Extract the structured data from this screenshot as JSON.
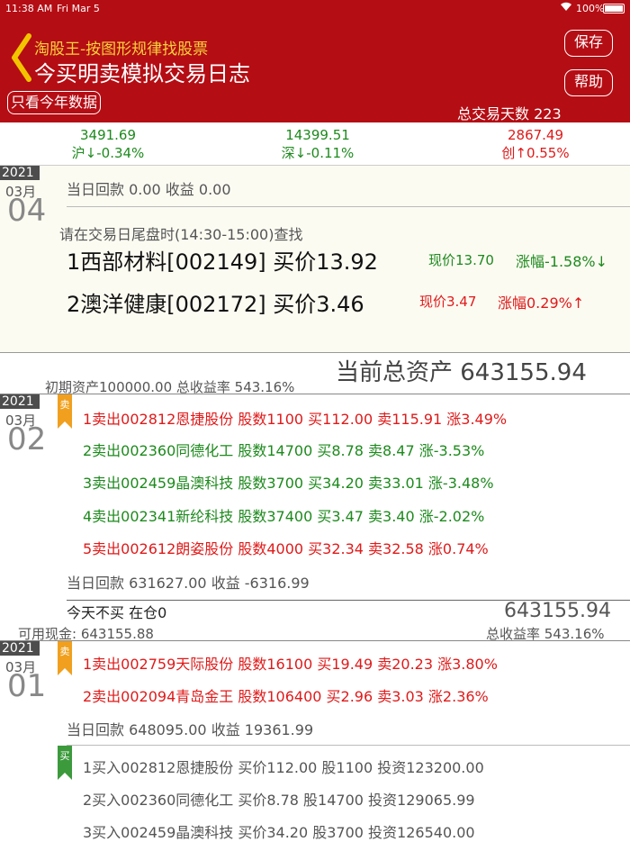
{
  "status": {
    "time": "11:38 AM",
    "date": "Fri Mar 5",
    "battery": "100%"
  },
  "header": {
    "app_name": "淘股王-按图形规律找股票",
    "title": "今买明卖模拟交易日志",
    "save_label": "保存",
    "help_label": "帮助",
    "filter_label": "只看今年数据",
    "total_days": "总交易天数 223"
  },
  "indices": [
    {
      "value": "3491.69",
      "change": "沪↓-0.34%"
    },
    {
      "value": "14399.51",
      "change": "深↓-0.11%"
    },
    {
      "value": "2867.49",
      "change": "创↑0.55%"
    }
  ],
  "today": {
    "year": "2021",
    "month": "03月",
    "day": "04",
    "summary": "当日回款 0.00   收益 0.00",
    "hint": "请在交易日尾盘时(14:30-15:00)查找",
    "picks": [
      {
        "text": "1西部材料[002149]  买价13.92",
        "price": "现价13.70",
        "change": "涨幅-1.58%↓"
      },
      {
        "text": "2澳洋健康[002172]  买价3.46",
        "price": "现价3.47",
        "change": "涨幅0.29%↑"
      }
    ]
  },
  "assets": {
    "total_label": "当前总资产 643155.94",
    "initial": "初期资产100000.00 总收益率 543.16%"
  },
  "day_02": {
    "year": "2021",
    "month": "03月",
    "day": "02",
    "badge": "卖",
    "trades": [
      {
        "text": "1卖出002812恩捷股份 股数1100 买112.00 卖115.91 涨3.49%"
      },
      {
        "text": "2卖出002360同德化工 股数14700 买8.78 卖8.47 涨-3.53%"
      },
      {
        "text": "3卖出002459晶澳科技 股数3700 买34.20 卖33.01 涨-3.48%"
      },
      {
        "text": "4卖出002341新纶科技 股数37400 买3.47 卖3.40 涨-2.02%"
      },
      {
        "text": "5卖出002612朗姿股份 股数4000 买32.34 卖32.58 涨0.74%"
      }
    ],
    "summary": "当日回款 631627.00   收益 -6316.99",
    "no_buy": "今天不买   在仓0",
    "total": "643155.94",
    "cash": "可用现金:  643155.88",
    "rate": "总收益率 543.16%"
  },
  "day_01": {
    "year": "2021",
    "month": "03月",
    "day": "01",
    "sell_badge": "卖",
    "buy_badge": "买",
    "trades": [
      {
        "text": "1卖出002759天际股份 股数16100 买19.49 卖20.23 涨3.80%"
      },
      {
        "text": "2卖出002094青岛金王 股数106400 买2.96 卖3.03 涨2.36%"
      }
    ],
    "summary": "当日回款 648095.00   收益 19361.99",
    "buys": [
      {
        "text": "1买入002812恩捷股份 买价112.00 股1100 投资123200.00"
      },
      {
        "text": "2买入002360同德化工 买价8.78 股14700 投资129065.99"
      },
      {
        "text": "3买入002459晶澳科技 买价34.20 股3700 投资126540.00"
      }
    ]
  },
  "colors": {
    "header_bg": "#b50d14",
    "gain": "#e01a1a",
    "loss": "#1d8a1d",
    "sell_ribbon": "#f0a01e",
    "buy_ribbon": "#3c9a3c"
  }
}
